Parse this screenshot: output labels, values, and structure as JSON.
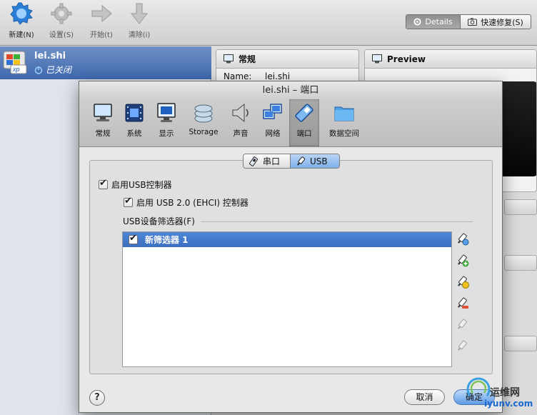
{
  "toolbar": {
    "new": "新建(N)",
    "settings": "设置(S)",
    "start": "开始(t)",
    "discard": "清除(i)",
    "details": "Details",
    "snapshots": "快速修复(S)"
  },
  "vm": {
    "name": "lei.shi",
    "os_badge": "xp",
    "state": "已关闭"
  },
  "details": {
    "general_title": "常规",
    "name_key": "Name:",
    "name_value": "lei.shi",
    "preview_title": "Preview"
  },
  "dialog": {
    "title": "lei.shi – 端口",
    "categories": [
      "常规",
      "系统",
      "显示",
      "Storage",
      "声音",
      "网络",
      "端口",
      "数据空间"
    ],
    "active_category": "端口",
    "subtabs": {
      "serial": "串口",
      "usb": "USB"
    },
    "usb_enable": "启用USB控制器",
    "usb2_enable": "启用 USB 2.0 (EHCI) 控制器",
    "filters_label": "USB设备筛选器(F)",
    "filters": [
      {
        "name": "新筛选器 1",
        "enabled": true
      }
    ],
    "help": "?",
    "cancel": "取消",
    "ok": "确定"
  },
  "watermark": {
    "cn": "运维网",
    "url": "iyunv.com"
  },
  "colors": {
    "selection": "#3b6fc0",
    "vm_row": "#4a71b4",
    "ok_button": "#5e9ae4"
  }
}
